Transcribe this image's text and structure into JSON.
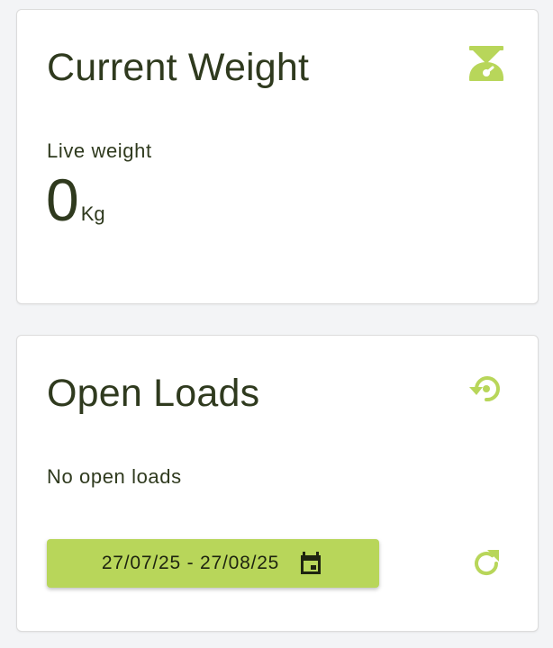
{
  "colors": {
    "accent": "#b8d65a",
    "icon": "#b8d65a",
    "text": "#2f3a1e",
    "background": "#f3f4f6",
    "card": "#ffffff"
  },
  "weight_card": {
    "title": "Current Weight",
    "icon": "scale-icon",
    "label": "Live weight",
    "value": "0",
    "unit": "Kg"
  },
  "loads_card": {
    "title": "Open Loads",
    "icon": "history-icon",
    "status": "No open loads",
    "date_range": "27/07/25 - 27/08/25",
    "date_icon": "calendar-icon",
    "refresh_icon": "refresh-icon"
  }
}
